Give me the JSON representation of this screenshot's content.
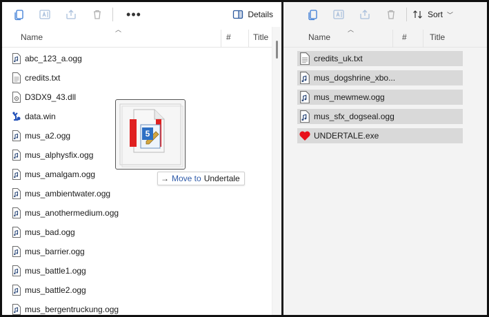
{
  "toolbar_left": {
    "details_label": "Details",
    "more_label": "•••"
  },
  "toolbar_right": {
    "sort_label": "Sort"
  },
  "left_pane": {
    "columns": [
      "Name",
      "#",
      "Title"
    ],
    "files": [
      {
        "name": "abc_123_a.ogg",
        "icon": "audio-file-icon"
      },
      {
        "name": "credits.txt",
        "icon": "text-file-icon"
      },
      {
        "name": "D3DX9_43.dll",
        "icon": "dll-file-icon"
      },
      {
        "name": "data.win",
        "icon": "data-file-icon"
      },
      {
        "name": "mus_a2.ogg",
        "icon": "audio-file-icon"
      },
      {
        "name": "mus_alphysfix.ogg",
        "icon": "audio-file-icon"
      },
      {
        "name": "mus_amalgam.ogg",
        "icon": "audio-file-icon"
      },
      {
        "name": "mus_ambientwater.ogg",
        "icon": "audio-file-icon"
      },
      {
        "name": "mus_anothermedium.ogg",
        "icon": "audio-file-icon"
      },
      {
        "name": "mus_bad.ogg",
        "icon": "audio-file-icon"
      },
      {
        "name": "mus_barrier.ogg",
        "icon": "audio-file-icon"
      },
      {
        "name": "mus_battle1.ogg",
        "icon": "audio-file-icon"
      },
      {
        "name": "mus_battle2.ogg",
        "icon": "audio-file-icon"
      },
      {
        "name": "mus_bergentruckung.ogg",
        "icon": "audio-file-icon"
      }
    ]
  },
  "right_pane": {
    "columns": [
      "Name",
      "#",
      "Title"
    ],
    "files": [
      {
        "name": "credits_uk.txt",
        "icon": "text-file-icon"
      },
      {
        "name": "mus_dogshrine_xbo...",
        "icon": "audio-file-icon"
      },
      {
        "name": "mus_mewmew.ogg",
        "icon": "audio-file-icon"
      },
      {
        "name": "mus_sfx_dogseal.ogg",
        "icon": "audio-file-icon"
      },
      {
        "name": "UNDERTALE.exe",
        "icon": "heart-exe-icon"
      }
    ]
  },
  "drag": {
    "badge_count": "5",
    "verb": "Move to",
    "target": "Undertale"
  },
  "colors": {
    "selection": "#d9d9d9",
    "heart": "#e8101a",
    "tip_verb": "#2e5aa8"
  }
}
